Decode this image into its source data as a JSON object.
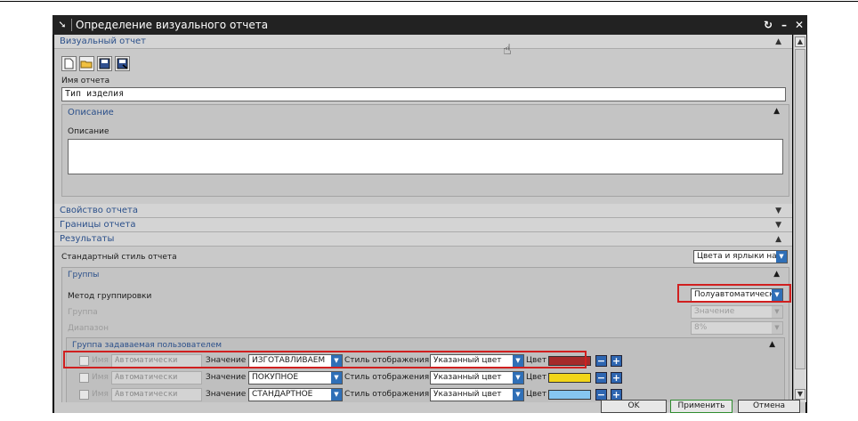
{
  "window": {
    "title": "Определение визуального отчета",
    "buttons": {
      "refresh": "↻",
      "minimize": "–",
      "close": "✕"
    }
  },
  "visual_report": {
    "header": "Визуальный отчет",
    "name_label": "Имя отчета",
    "name_value": "Тип изделия",
    "description": {
      "header": "Описание",
      "label": "Описание",
      "value": ""
    }
  },
  "sections": {
    "report_property": "Свойство отчета",
    "report_bounds": "Границы отчета",
    "results": "Результаты"
  },
  "results": {
    "standard_style_label": "Стандартный стиль отчета",
    "standard_style_value": "Цвета и ярлыки на г",
    "groups": {
      "header": "Группы",
      "method_label": "Метод группировки",
      "method_value": "Полуавтоматическ",
      "group_label": "Группа",
      "group_value": "Значение",
      "range_label": "Диапазон",
      "range_value": "8%"
    },
    "user_group": {
      "header": "Группа задаваемая пользователем",
      "rows": [
        {
          "name_label": "Имя",
          "name_value": "Автоматически",
          "value_label": "Значение",
          "value": "ИЗГОТАВЛИВАЕМ",
          "style_label": "Стиль отображения",
          "style_value": "Указанный цвет",
          "color_label": "Цвет",
          "color": "#a52a2a"
        },
        {
          "name_label": "Имя",
          "name_value": "Автоматически",
          "value_label": "Значение",
          "value": "ПОКУПНОЕ",
          "style_label": "Стиль отображения",
          "style_value": "Указанный цвет",
          "color_label": "Цвет",
          "color": "#f2d519"
        },
        {
          "name_label": "Имя",
          "name_value": "Автоматически",
          "value_label": "Значение",
          "value": "СТАНДАРТНОЕ",
          "style_label": "Стиль отображения",
          "style_value": "Указанный цвет",
          "color_label": "Цвет",
          "color": "#86c6f0"
        }
      ]
    }
  },
  "footer": {
    "ok": "OK",
    "apply": "Применить",
    "cancel": "Отмена"
  },
  "colors": {
    "highlight": "#d01f1f",
    "accent": "#2f6fb7",
    "apply_border": "#2e8b2e"
  },
  "icons": [
    "new-icon",
    "open-folder-icon",
    "save-icon",
    "save-as-icon",
    "chevron-up-icon",
    "chevron-down-icon",
    "plus-icon",
    "minus-icon",
    "dropdown-arrow-icon"
  ]
}
